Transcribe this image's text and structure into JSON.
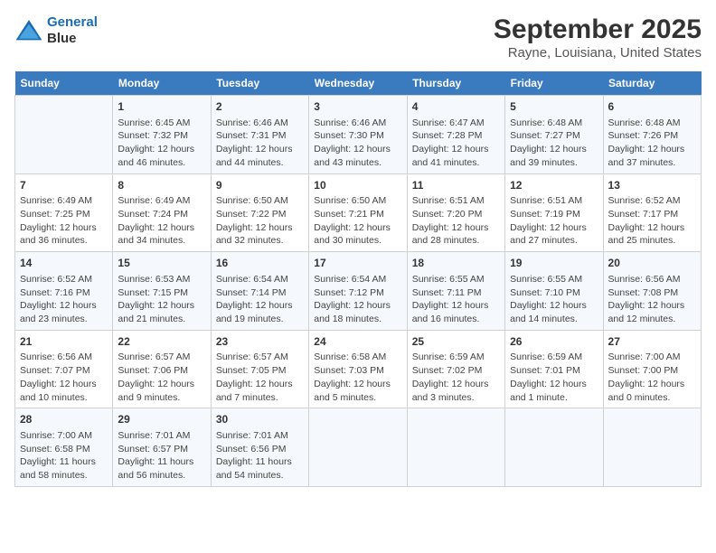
{
  "header": {
    "logo_line1": "General",
    "logo_line2": "Blue",
    "title": "September 2025",
    "subtitle": "Rayne, Louisiana, United States"
  },
  "weekdays": [
    "Sunday",
    "Monday",
    "Tuesday",
    "Wednesday",
    "Thursday",
    "Friday",
    "Saturday"
  ],
  "weeks": [
    [
      {
        "day": "",
        "info": ""
      },
      {
        "day": "1",
        "info": "Sunrise: 6:45 AM\nSunset: 7:32 PM\nDaylight: 12 hours\nand 46 minutes."
      },
      {
        "day": "2",
        "info": "Sunrise: 6:46 AM\nSunset: 7:31 PM\nDaylight: 12 hours\nand 44 minutes."
      },
      {
        "day": "3",
        "info": "Sunrise: 6:46 AM\nSunset: 7:30 PM\nDaylight: 12 hours\nand 43 minutes."
      },
      {
        "day": "4",
        "info": "Sunrise: 6:47 AM\nSunset: 7:28 PM\nDaylight: 12 hours\nand 41 minutes."
      },
      {
        "day": "5",
        "info": "Sunrise: 6:48 AM\nSunset: 7:27 PM\nDaylight: 12 hours\nand 39 minutes."
      },
      {
        "day": "6",
        "info": "Sunrise: 6:48 AM\nSunset: 7:26 PM\nDaylight: 12 hours\nand 37 minutes."
      }
    ],
    [
      {
        "day": "7",
        "info": "Sunrise: 6:49 AM\nSunset: 7:25 PM\nDaylight: 12 hours\nand 36 minutes."
      },
      {
        "day": "8",
        "info": "Sunrise: 6:49 AM\nSunset: 7:24 PM\nDaylight: 12 hours\nand 34 minutes."
      },
      {
        "day": "9",
        "info": "Sunrise: 6:50 AM\nSunset: 7:22 PM\nDaylight: 12 hours\nand 32 minutes."
      },
      {
        "day": "10",
        "info": "Sunrise: 6:50 AM\nSunset: 7:21 PM\nDaylight: 12 hours\nand 30 minutes."
      },
      {
        "day": "11",
        "info": "Sunrise: 6:51 AM\nSunset: 7:20 PM\nDaylight: 12 hours\nand 28 minutes."
      },
      {
        "day": "12",
        "info": "Sunrise: 6:51 AM\nSunset: 7:19 PM\nDaylight: 12 hours\nand 27 minutes."
      },
      {
        "day": "13",
        "info": "Sunrise: 6:52 AM\nSunset: 7:17 PM\nDaylight: 12 hours\nand 25 minutes."
      }
    ],
    [
      {
        "day": "14",
        "info": "Sunrise: 6:52 AM\nSunset: 7:16 PM\nDaylight: 12 hours\nand 23 minutes."
      },
      {
        "day": "15",
        "info": "Sunrise: 6:53 AM\nSunset: 7:15 PM\nDaylight: 12 hours\nand 21 minutes."
      },
      {
        "day": "16",
        "info": "Sunrise: 6:54 AM\nSunset: 7:14 PM\nDaylight: 12 hours\nand 19 minutes."
      },
      {
        "day": "17",
        "info": "Sunrise: 6:54 AM\nSunset: 7:12 PM\nDaylight: 12 hours\nand 18 minutes."
      },
      {
        "day": "18",
        "info": "Sunrise: 6:55 AM\nSunset: 7:11 PM\nDaylight: 12 hours\nand 16 minutes."
      },
      {
        "day": "19",
        "info": "Sunrise: 6:55 AM\nSunset: 7:10 PM\nDaylight: 12 hours\nand 14 minutes."
      },
      {
        "day": "20",
        "info": "Sunrise: 6:56 AM\nSunset: 7:08 PM\nDaylight: 12 hours\nand 12 minutes."
      }
    ],
    [
      {
        "day": "21",
        "info": "Sunrise: 6:56 AM\nSunset: 7:07 PM\nDaylight: 12 hours\nand 10 minutes."
      },
      {
        "day": "22",
        "info": "Sunrise: 6:57 AM\nSunset: 7:06 PM\nDaylight: 12 hours\nand 9 minutes."
      },
      {
        "day": "23",
        "info": "Sunrise: 6:57 AM\nSunset: 7:05 PM\nDaylight: 12 hours\nand 7 minutes."
      },
      {
        "day": "24",
        "info": "Sunrise: 6:58 AM\nSunset: 7:03 PM\nDaylight: 12 hours\nand 5 minutes."
      },
      {
        "day": "25",
        "info": "Sunrise: 6:59 AM\nSunset: 7:02 PM\nDaylight: 12 hours\nand 3 minutes."
      },
      {
        "day": "26",
        "info": "Sunrise: 6:59 AM\nSunset: 7:01 PM\nDaylight: 12 hours\nand 1 minute."
      },
      {
        "day": "27",
        "info": "Sunrise: 7:00 AM\nSunset: 7:00 PM\nDaylight: 12 hours\nand 0 minutes."
      }
    ],
    [
      {
        "day": "28",
        "info": "Sunrise: 7:00 AM\nSunset: 6:58 PM\nDaylight: 11 hours\nand 58 minutes."
      },
      {
        "day": "29",
        "info": "Sunrise: 7:01 AM\nSunset: 6:57 PM\nDaylight: 11 hours\nand 56 minutes."
      },
      {
        "day": "30",
        "info": "Sunrise: 7:01 AM\nSunset: 6:56 PM\nDaylight: 11 hours\nand 54 minutes."
      },
      {
        "day": "",
        "info": ""
      },
      {
        "day": "",
        "info": ""
      },
      {
        "day": "",
        "info": ""
      },
      {
        "day": "",
        "info": ""
      }
    ]
  ]
}
